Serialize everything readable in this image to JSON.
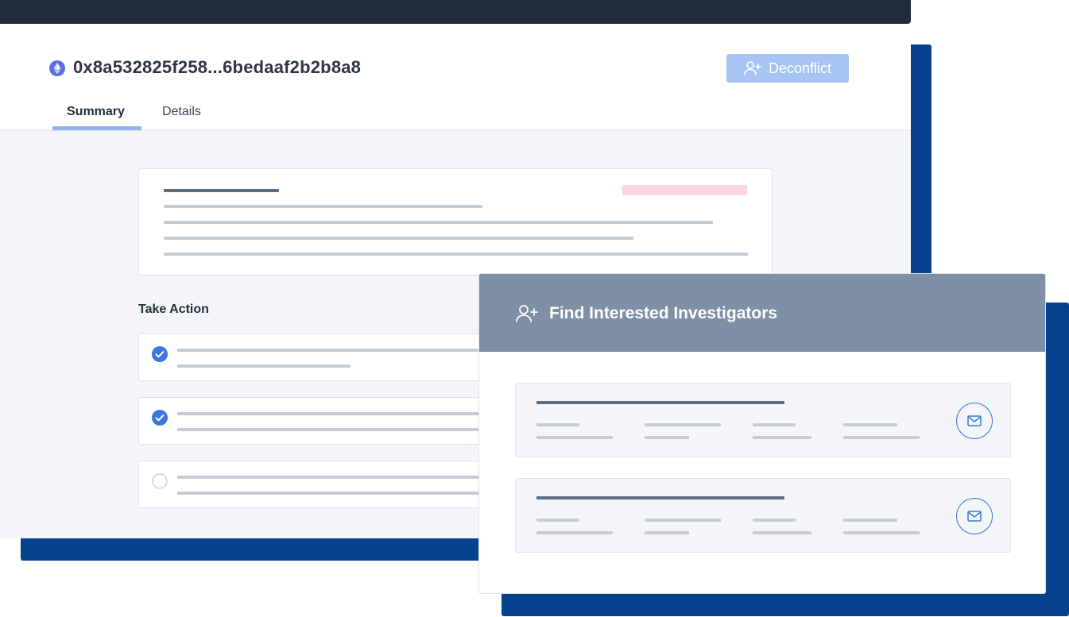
{
  "header": {
    "tx_hash": "0x8a532825f258...6bedaaf2b2b8a8",
    "deconflict_label": "Deconflict"
  },
  "tabs": [
    {
      "label": "Summary",
      "active": true
    },
    {
      "label": "Details",
      "active": false
    }
  ],
  "take_action": {
    "title": "Take Action",
    "items": [
      {
        "checked": true
      },
      {
        "checked": true
      },
      {
        "checked": false
      }
    ]
  },
  "modal": {
    "title": "Find Interested Investigators"
  },
  "colors": {
    "accent": "#3a78e0",
    "navy": "#06428c",
    "topbar": "#1f2d3d",
    "button_disabled": "#a6c4f2",
    "modal_header": "#7f8fa5",
    "alert_pink": "#fdd5dc"
  },
  "icons": {
    "chain": "ethereum-icon",
    "deconflict": "add-user-icon",
    "investigators": "add-user-icon",
    "contact": "mail-icon",
    "checked": "check-circle-icon",
    "unchecked": "empty-circle-icon"
  }
}
